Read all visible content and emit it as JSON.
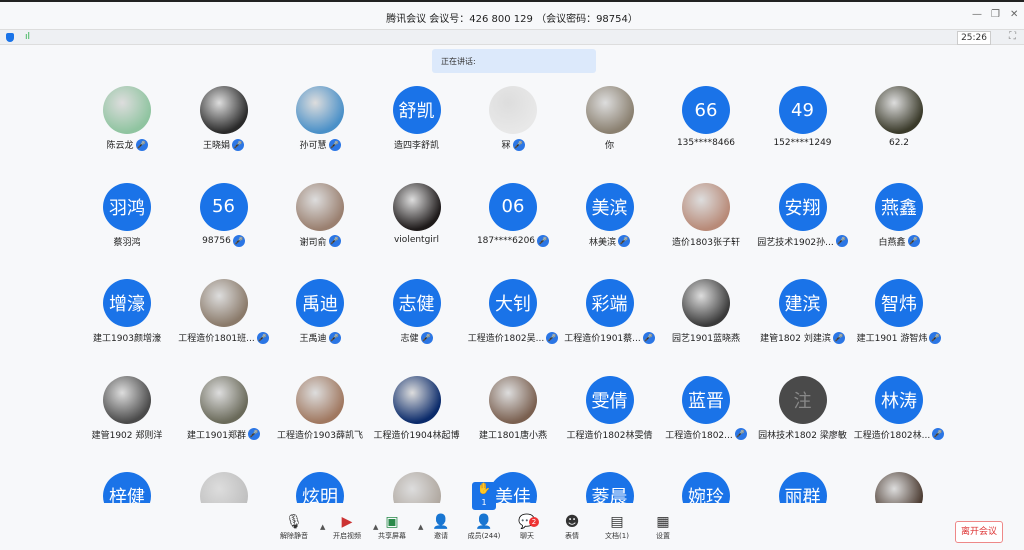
{
  "window": {
    "title": "腾讯会议 会议号：426 800 129 （会议密码：98754）",
    "minimize": "—",
    "restore": "❐",
    "close": "✕"
  },
  "status": {
    "signal": "ıl",
    "timer": "25:26",
    "fullscreen": "⛶"
  },
  "speaking": "正在讲话:",
  "colors": {
    "accent": "#1a73e8",
    "avatar_blue": "#1a73e8",
    "avatar_gray": "#4a4a4a",
    "leave": "#d33333"
  },
  "participants": [
    {
      "name": "陈云龙",
      "avatar": "",
      "photo": "#8fc4a0",
      "mic": true
    },
    {
      "name": "王晓娟",
      "avatar": "",
      "photo": "#2a2a2a",
      "mic": true
    },
    {
      "name": "孙可慧",
      "avatar": "",
      "photo": "#4a90c8",
      "mic": true
    },
    {
      "name": "造四李舒凯",
      "avatar": "舒凯",
      "mic": false
    },
    {
      "name": "冧",
      "avatar": "",
      "photo": "#e8e8e8",
      "mic": true
    },
    {
      "name": "你",
      "avatar": "",
      "photo": "#8a8070",
      "mic": false
    },
    {
      "name": "135****8466",
      "avatar": "66",
      "mic": false
    },
    {
      "name": "152****1249",
      "avatar": "49",
      "mic": false
    },
    {
      "name": "62.2",
      "avatar": "",
      "photo": "#3a3a2a",
      "mic": false
    },
    {
      "name": "蔡羽鸿",
      "avatar": "羽鸿",
      "mic": false
    },
    {
      "name": "98756",
      "avatar": "56",
      "mic": true
    },
    {
      "name": "谢司俞",
      "avatar": "",
      "photo": "#9a8070",
      "mic": true
    },
    {
      "name": "violentgirl",
      "avatar": "",
      "photo": "#1e1a1a",
      "mic": false
    },
    {
      "name": "187****6206",
      "avatar": "06",
      "mic": true
    },
    {
      "name": "林美滨",
      "avatar": "美滨",
      "mic": true
    },
    {
      "name": "造价1803张子轩",
      "avatar": "",
      "photo": "#b88a78",
      "mic": false
    },
    {
      "name": "园艺技术1902孙...",
      "avatar": "安翔",
      "mic": true
    },
    {
      "name": "白燕鑫",
      "avatar": "燕鑫",
      "mic": true
    },
    {
      "name": "建工1903颜增濠",
      "avatar": "增濠",
      "mic": false
    },
    {
      "name": "工程造价1801班...",
      "avatar": "",
      "photo": "#8a7a6a",
      "mic": true
    },
    {
      "name": "王禹迪",
      "avatar": "禹迪",
      "mic": true
    },
    {
      "name": "志健",
      "avatar": "志健",
      "mic": true
    },
    {
      "name": "工程造价1802吴...",
      "avatar": "大钊",
      "mic": true
    },
    {
      "name": "工程造价1901蔡...",
      "avatar": "彩端",
      "mic": true
    },
    {
      "name": "园艺1901蓝晓燕",
      "avatar": "",
      "photo": "#3a3a3a",
      "mic": false
    },
    {
      "name": "建管1802 刘建滨",
      "avatar": "建滨",
      "mic": true
    },
    {
      "name": "建工1901 游智炜",
      "avatar": "智炜",
      "mic": true
    },
    {
      "name": "建管1902 郑则洋",
      "avatar": "",
      "photo": "#4a4a4a",
      "mic": false
    },
    {
      "name": "建工1901郑群",
      "avatar": "",
      "photo": "#6a6a5a",
      "mic": true
    },
    {
      "name": "工程造价1903薛凯飞",
      "avatar": "",
      "photo": "#a07860",
      "mic": false
    },
    {
      "name": "工程造价1904林起博",
      "avatar": "",
      "photo": "#0a2a6a",
      "mic": false
    },
    {
      "name": "建工1801唐小燕",
      "avatar": "",
      "photo": "#7a6050",
      "mic": false
    },
    {
      "name": "工程造价1802林雯倩",
      "avatar": "雯倩",
      "mic": false
    },
    {
      "name": "工程造价1802...",
      "avatar": "蓝晋",
      "mic": true
    },
    {
      "name": "园林技术1802 梁廖敏",
      "avatar": "注",
      "gray": true,
      "mic": false
    },
    {
      "name": "工程造价1802林...",
      "avatar": "林涛",
      "mic": true
    },
    {
      "name": "",
      "avatar": "梓健",
      "mic": false
    },
    {
      "name": "",
      "avatar": "",
      "photo": "#c0c0c0",
      "mic": false
    },
    {
      "name": "",
      "avatar": "炫明",
      "mic": false
    },
    {
      "name": "",
      "avatar": "",
      "photo": "#b0a8a0",
      "mic": false
    },
    {
      "name": "",
      "avatar": "美佳",
      "mic": false
    },
    {
      "name": "",
      "avatar": "菱晨",
      "mic": false
    },
    {
      "name": "",
      "avatar": "婉玲",
      "mic": false
    },
    {
      "name": "",
      "avatar": "丽群",
      "mic": false
    },
    {
      "name": "",
      "avatar": "",
      "photo": "#4a3a30",
      "mic": false
    }
  ],
  "raised_hands": {
    "icon": "✋",
    "count": "1"
  },
  "toolbar": [
    {
      "id": "unmute",
      "label": "解除静音",
      "icon": "🎙",
      "caret": true
    },
    {
      "id": "start-video",
      "label": "开启视频",
      "icon": "▶",
      "caret": true
    },
    {
      "id": "share-screen",
      "label": "共享屏幕",
      "icon": "▣",
      "caret": true
    },
    {
      "id": "invite",
      "label": "邀请",
      "icon": "👤"
    },
    {
      "id": "members",
      "label": "成员(244)",
      "icon": "👤"
    },
    {
      "id": "chat",
      "label": "聊天",
      "icon": "💬"
    },
    {
      "id": "reactions",
      "label": "表情",
      "icon": "☻"
    },
    {
      "id": "docs",
      "label": "文档(1)",
      "icon": "▤"
    },
    {
      "id": "settings",
      "label": "设置",
      "icon": "▦"
    }
  ],
  "chat_badge": "2",
  "leave_label": "离开会议"
}
